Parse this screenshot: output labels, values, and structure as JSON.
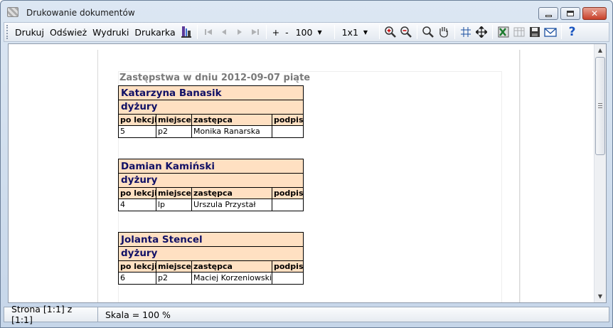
{
  "window": {
    "title": "Drukowanie dokumentów"
  },
  "toolbar": {
    "print_label": "Drukuj",
    "refresh_label": "Odśwież",
    "printouts_label": "Wydruki",
    "printer_label": "Drukarka",
    "zoom_plus": "+",
    "zoom_minus": "-",
    "zoom_value": "100",
    "pages_layout": "1x1"
  },
  "report": {
    "title": "Zastępstwa w dniu 2012-09-07 piąte",
    "headers": {
      "lesson": "po lekcji",
      "place": "miejsce",
      "substitute": "zastępca",
      "signature": "podpis"
    },
    "blocks": [
      {
        "name": "Katarzyna Banasik",
        "section": "dyżury",
        "rows": [
          {
            "lesson": "5",
            "place": "p2",
            "substitute": "Monika Ranarska",
            "signature": ""
          }
        ]
      },
      {
        "name": "Damian Kamiński",
        "section": "dyżury",
        "rows": [
          {
            "lesson": "4",
            "place": "lp",
            "substitute": "Urszula Przystał",
            "signature": ""
          }
        ]
      },
      {
        "name": "Jolanta Stencel",
        "section": "dyżury",
        "rows": [
          {
            "lesson": "6",
            "place": "p2",
            "substitute": "Maciej Korzeniowski",
            "signature": ""
          }
        ]
      }
    ]
  },
  "status": {
    "page_info": "Strona [1:1] z [1:1]",
    "scale_info": "Skala = 100 %"
  },
  "colors": {
    "header_fill": "#ffe0c2",
    "name_text": "#111166",
    "title_text": "#7a7a7a"
  }
}
